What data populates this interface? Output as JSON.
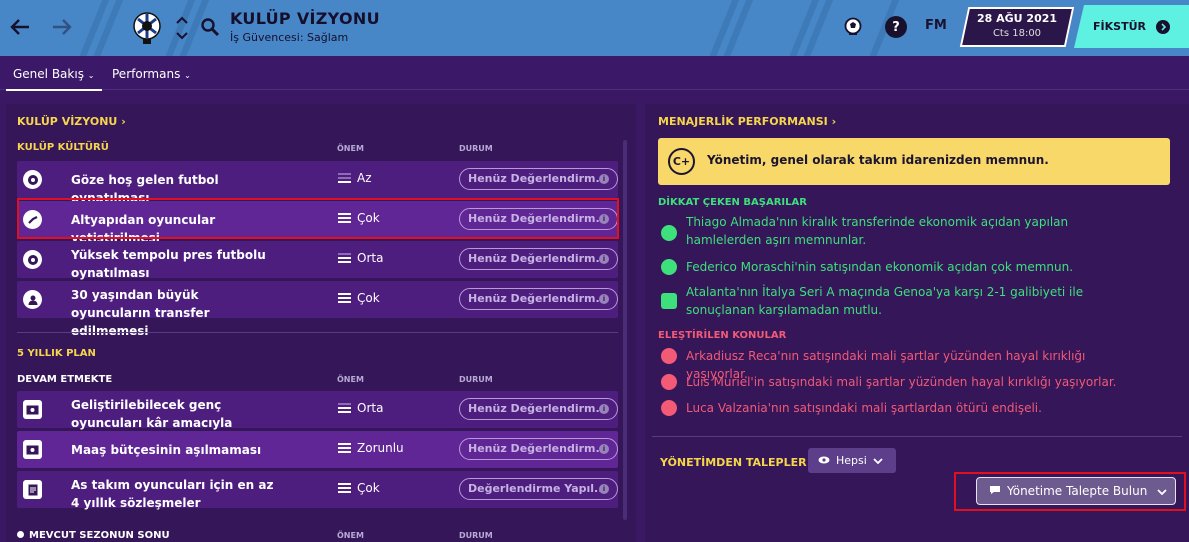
{
  "topbar": {
    "title": "KULÜP VİZYONU",
    "subtitle": "İş Güvencesi: Sağlam",
    "brand": "FM",
    "date": "28 AĞU 2021",
    "day_time": "Cts 18:00",
    "continue_label": "FİKSTÜR",
    "icons": [
      "back-arrow-icon",
      "forward-arrow-icon",
      "club-crest-icon",
      "chevron-up-icon",
      "chevron-down-icon",
      "search-icon",
      "ball-icon",
      "help-icon",
      "chevron-right-circle-icon"
    ]
  },
  "tabs": [
    {
      "label": "Genel Bakış"
    },
    {
      "label": "Performans"
    }
  ],
  "vision": {
    "title": "KULÜP VİZYONU",
    "culture_header": "KULÜP KÜLTÜRÜ",
    "col_importance": "ÖNEM",
    "col_status": "DURUM",
    "culture_rows": [
      {
        "text": "Göze hoş gelen futbol oynatılması",
        "importance": "Az",
        "status": "Henüz Değerlendirm..."
      },
      {
        "text": "Altyapıdan oyuncular yetiştirilmesi",
        "importance": "Çok",
        "status": "Henüz Değerlendirm..."
      },
      {
        "text": "Yüksek tempolu pres futbolu oynatılması",
        "importance": "Orta",
        "status": "Henüz Değerlendirm..."
      },
      {
        "text": "30 yaşından büyük oyuncuların transfer edilmemesi",
        "importance": "Çok",
        "status": "Henüz Değerlendirm..."
      }
    ],
    "plan_header": "5 YILLIK PLAN",
    "ongoing_header": "DEVAM ETMEKTE",
    "plan_rows": [
      {
        "text": "Geliştirilebilecek genç oyuncuları kâr amacıyla transfer etme",
        "importance": "Orta",
        "status": "Henüz Değerlendirm..."
      },
      {
        "text": "Maaş bütçesinin aşılmaması",
        "importance": "Zorunlu",
        "status": "Henüz Değerlendirm..."
      },
      {
        "text": "As takım oyuncuları için en az 4 yıllık sözleşmeler",
        "importance": "Çok",
        "status": "Değerlendirme Yapıl..."
      }
    ],
    "season_header": "MEVCUT SEZONUN SONU"
  },
  "performance": {
    "title": "MENAJERLİK PERFORMANSI",
    "grade": "C+",
    "summary": "Yönetim, genel olarak takım idarenizden memnun.",
    "achievements_header": "DİKKAT ÇEKEN BAŞARILAR",
    "achievements": [
      "Thiago Almada'nın kiralık transferinde ekonomik açıdan yapılan hamlelerden aşırı memnunlar.",
      "Federico Moraschi'nin satışından ekonomik açıdan çok memnun.",
      "Atalanta'nın İtalya Seri A maçında Genoa'ya karşı 2-1 galibiyeti ile sonuçlanan karşılamadan mutlu."
    ],
    "criticism_header": "ELEŞTİRİLEN KONULAR",
    "criticisms": [
      "Arkadiusz Reca'nın satışındaki mali şartlar yüzünden hayal kırıklığı yaşıyorlar.",
      "Luis Muriel'in satışındaki mali şartlar yüzünden hayal kırıklığı yaşıyorlar.",
      "Luca Valzania'nın satışındaki mali şartlardan ötürü endişeli."
    ],
    "requests_header": "YÖNETİMDEN TALEPLER",
    "filter_label": "Hepsi",
    "request_button": "Yönetime Talepte Bulun"
  },
  "colors": {
    "accent_yellow": "#f5d64a",
    "positive": "#3ee07b",
    "negative": "#f25a76",
    "topbar": "#4787c7",
    "continue": "#5ef0e0"
  }
}
